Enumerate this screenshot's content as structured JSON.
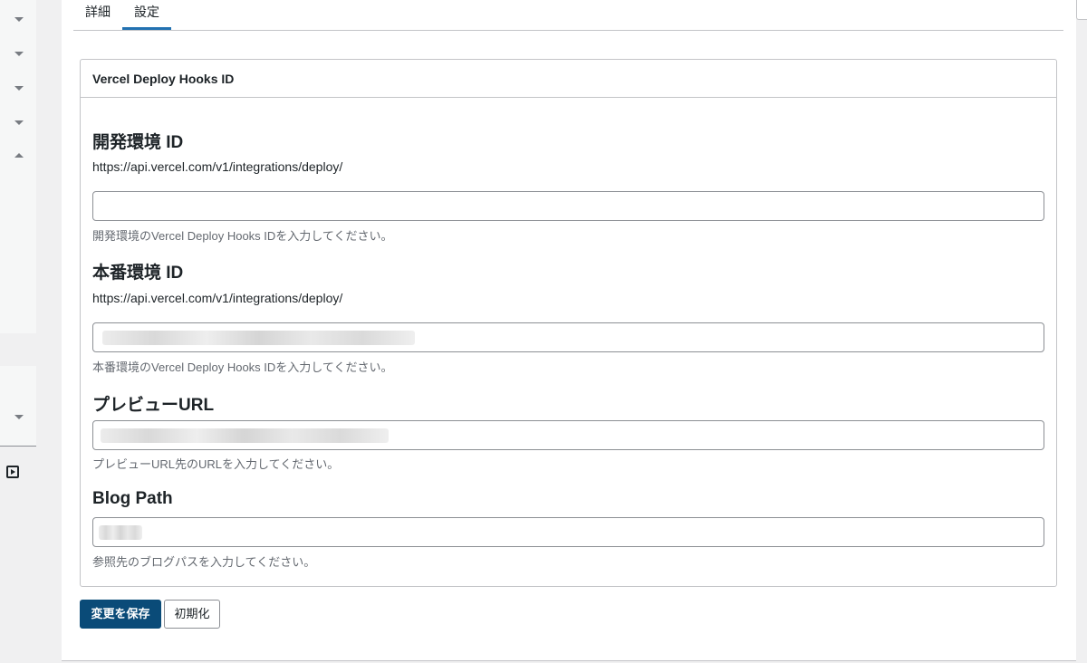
{
  "tabs": [
    {
      "label": "詳細"
    },
    {
      "label": "設定"
    }
  ],
  "card": {
    "title": "Vercel Deploy Hooks ID"
  },
  "fields": [
    {
      "label": "開発環境 ID",
      "url": "https://api.vercel.com/v1/integrations/deploy/",
      "value": "",
      "help": "開発環境のVercel Deploy Hooks IDを入力してください。"
    },
    {
      "label": "本番環境 ID",
      "url": "https://api.vercel.com/v1/integrations/deploy/",
      "help": "本番環境のVercel Deploy Hooks IDを入力してください。"
    },
    {
      "label": "プレビューURL",
      "help": "プレビューURL先のURLを入力してください。"
    },
    {
      "label": "Blog Path",
      "help": "参照先のブログパスを入力してください。"
    }
  ],
  "buttons": {
    "save": "変更を保存",
    "reset": "初期化"
  },
  "colors": {
    "primary": "#0a4b78",
    "tab_active": "#2271b1",
    "border": "#c3c4c7",
    "help_text": "#646970"
  }
}
